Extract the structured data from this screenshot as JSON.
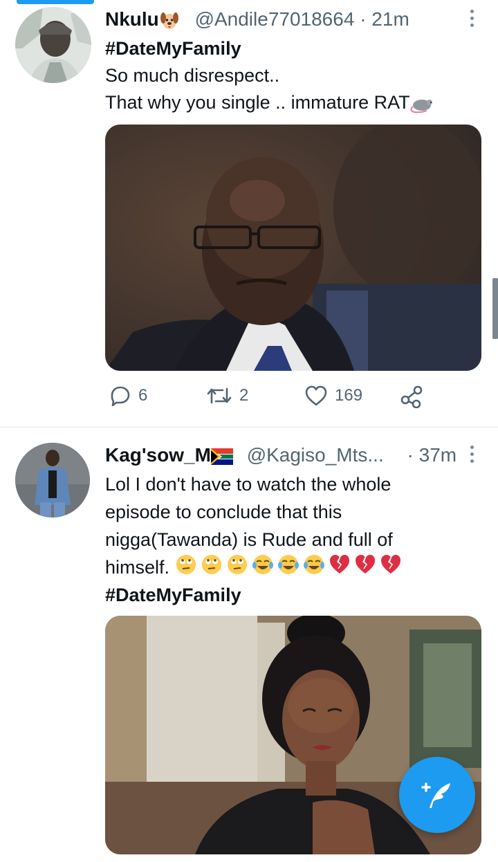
{
  "tweets": [
    {
      "display_name": "Nkulu",
      "name_emoji": "dog-face-emoji",
      "handle": "@Andile77018664",
      "separator": "·",
      "time": "21m",
      "hashtag": "#DateMyFamily",
      "lines": [
        "So much disrespect..",
        "That why you single .. immature RAT"
      ],
      "trailing_emoji": "rat-emoji",
      "media_alt": "photo-older-man-glasses-suit",
      "replies": "6",
      "retweets": "2",
      "likes": "169"
    },
    {
      "display_name": "Kag'sow_M",
      "name_emoji": "south-africa-flag-emoji",
      "handle": "@Kagiso_Mts...",
      "separator": "·",
      "time": "37m",
      "lines": [
        "Lol I don't have to watch the whole",
        "episode to conclude that this",
        "nigga(Tawanda) is Rude  and full of",
        "himself."
      ],
      "emoji_sequence": [
        "rolling-eyes",
        "rolling-eyes",
        "rolling-eyes",
        "tears-of-joy",
        "tears-of-joy",
        "tears-of-joy",
        "broken-heart",
        "broken-heart",
        "broken-heart"
      ],
      "hashtag": "#DateMyFamily",
      "media_alt": "photo-woman-hair-bun-hand-on-chest"
    }
  ],
  "fab": {
    "icon": "compose-tweet-icon",
    "label": "+"
  },
  "colors": {
    "accent": "#1d9bf0",
    "muted": "#536471",
    "text": "#0f1419"
  }
}
